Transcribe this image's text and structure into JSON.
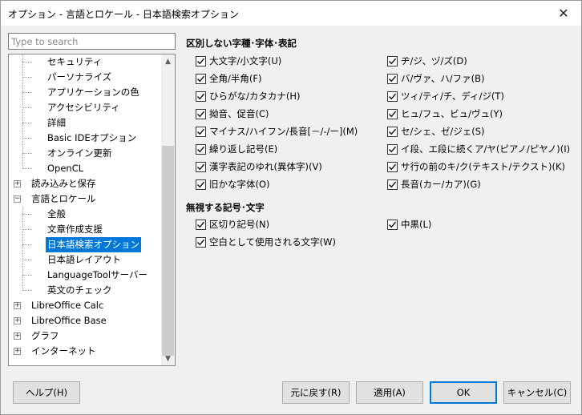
{
  "window": {
    "title": "オプション - 言語とロケール - 日本語検索オプション",
    "close_glyph": "✕"
  },
  "search": {
    "placeholder": "Type to search",
    "value": ""
  },
  "tree": {
    "items": [
      {
        "label": "セキュリティ"
      },
      {
        "label": "パーソナライズ"
      },
      {
        "label": "アプリケーションの色"
      },
      {
        "label": "アクセシビリティ"
      },
      {
        "label": "詳細"
      },
      {
        "label": "Basic IDEオプション"
      },
      {
        "label": "オンライン更新"
      },
      {
        "label": "OpenCL"
      },
      {
        "label": "読み込みと保存",
        "expander": "+"
      },
      {
        "label": "言語とロケール",
        "expander": "−"
      },
      {
        "label": "全般"
      },
      {
        "label": "文章作成支援"
      },
      {
        "label": "日本語検索オプション",
        "selected": true
      },
      {
        "label": "日本語レイアウト"
      },
      {
        "label": "LanguageToolサーバー"
      },
      {
        "label": "英文のチェック"
      },
      {
        "label": "LibreOffice Calc",
        "expander": "+"
      },
      {
        "label": "LibreOffice Base",
        "expander": "+"
      },
      {
        "label": "グラフ",
        "expander": "+"
      },
      {
        "label": "インターネット",
        "expander": "+"
      }
    ],
    "scroll_up_glyph": "▲",
    "scroll_down_glyph": "▼"
  },
  "sections": {
    "treat_as_equal": {
      "title": "区別しない字種･字体･表記",
      "left": [
        {
          "label": "大文字/小文字(U)",
          "checked": true
        },
        {
          "label": "全角/半角(F)",
          "checked": true
        },
        {
          "label": "ひらがな/カタカナ(H)",
          "checked": true
        },
        {
          "label": "拗音、促音(C)",
          "checked": true
        },
        {
          "label": "マイナス/ハイフン/長音[－/-/ー](M)",
          "checked": true
        },
        {
          "label": "繰り返し記号(E)",
          "checked": true
        },
        {
          "label": "漢字表記のゆれ(異体字)(V)",
          "checked": true
        },
        {
          "label": "旧かな字体(O)",
          "checked": true
        }
      ],
      "right": [
        {
          "label": "ヂ/ジ、ヅ/ズ(D)",
          "checked": true
        },
        {
          "label": "バ/ヴァ、ハ/ファ(B)",
          "checked": true
        },
        {
          "label": "ツィ/ティ/チ、ディ/ジ(T)",
          "checked": true
        },
        {
          "label": "ヒュ/フュ、ビュ/ヴュ(Y)",
          "checked": true
        },
        {
          "label": "セ/シェ、ゼ/ジェ(S)",
          "checked": true
        },
        {
          "label": "イ段、エ段に続くア/ヤ(ピアノ/ピヤノ)(I)",
          "checked": true
        },
        {
          "label": "サ行の前のキ/ク(テキスト/テクスト)(K)",
          "checked": true
        },
        {
          "label": "長音(カー/カア)(G)",
          "checked": true
        }
      ]
    },
    "ignore": {
      "title": "無視する記号･文字",
      "left": [
        {
          "label": "区切り記号(N)",
          "checked": true
        },
        {
          "label": "空白として使用される文字(W)",
          "checked": true
        }
      ],
      "right": [
        {
          "label": "中黒(L)",
          "checked": true
        }
      ]
    }
  },
  "buttons": {
    "help": "ヘルプ(H)",
    "reset": "元に戻す(R)",
    "apply": "適用(A)",
    "ok": "OK",
    "cancel": "キャンセル(C)"
  }
}
